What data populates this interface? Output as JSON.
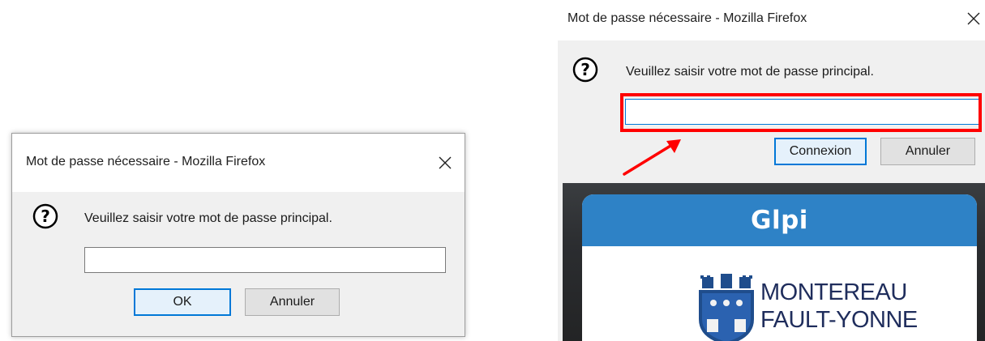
{
  "left_dialog": {
    "title": "Mot de passe nécessaire - Mozilla Firefox",
    "prompt": "Veuillez saisir votre mot de passe principal.",
    "password_value": "",
    "ok_label": "OK",
    "cancel_label": "Annuler",
    "icons": {
      "help": "question-circle-icon",
      "close": "close-icon"
    }
  },
  "right_dialog": {
    "title": "Mot de passe nécessaire - Mozilla Firefox",
    "prompt": "Veuillez saisir votre mot de passe principal.",
    "password_value": "",
    "ok_label": "Connexion",
    "cancel_label": "Annuler",
    "icons": {
      "help": "question-circle-icon",
      "close": "close-icon"
    },
    "highlight_color": "#ff0000",
    "annotation_arrow_color": "#ff0000"
  },
  "background_page": {
    "logo_text": "Glpi",
    "town_line1": "MONTEREAU",
    "town_line2": "FAULT-YONNE",
    "header_color": "#2e82c6"
  }
}
